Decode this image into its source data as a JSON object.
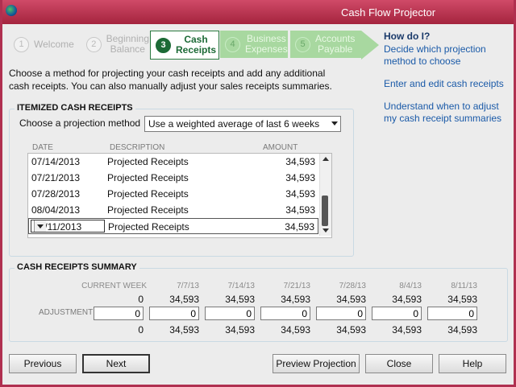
{
  "window": {
    "title": "Cash Flow Projector"
  },
  "wizard": {
    "steps": [
      {
        "num": "1",
        "label": "Welcome"
      },
      {
        "num": "2",
        "label": "Beginning\nBalance"
      },
      {
        "num": "3",
        "label": "Cash\nReceipts"
      },
      {
        "num": "4",
        "label": "Business\nExpenses"
      },
      {
        "num": "5",
        "label": "Accounts\nPayable"
      }
    ]
  },
  "intro": "Choose a method for projecting your cash receipts and add any additional cash receipts. You can also manually adjust your sales receipts summaries.",
  "help": {
    "header": "How do I?",
    "links": [
      "Decide which projection method to choose",
      "Enter and edit cash receipts",
      "Understand when to adjust my cash receipt summaries"
    ]
  },
  "itemized": {
    "title": "ITEMIZED CASH RECEIPTS",
    "method_label": "Choose a projection method",
    "method_value": "Use a weighted average of last 6 weeks",
    "columns": [
      "DATE",
      "DESCRIPTION",
      "AMOUNT"
    ],
    "rows": [
      {
        "date": "07/14/2013",
        "desc": "Projected Receipts",
        "amount": "34,593"
      },
      {
        "date": "07/21/2013",
        "desc": "Projected Receipts",
        "amount": "34,593"
      },
      {
        "date": "07/28/2013",
        "desc": "Projected Receipts",
        "amount": "34,593"
      },
      {
        "date": "08/04/2013",
        "desc": "Projected Receipts",
        "amount": "34,593"
      },
      {
        "date": "08/11/2013",
        "desc": "Projected Receipts",
        "amount": "34,593"
      }
    ]
  },
  "summary": {
    "title": "CASH RECEIPTS SUMMARY",
    "adjustment_label": "ADJUSTMENT",
    "columns": [
      {
        "head": "CURRENT WEEK",
        "top": "0",
        "adj": "0",
        "bottom": "0"
      },
      {
        "head": "7/7/13",
        "top": "34,593",
        "adj": "0",
        "bottom": "34,593"
      },
      {
        "head": "7/14/13",
        "top": "34,593",
        "adj": "0",
        "bottom": "34,593"
      },
      {
        "head": "7/21/13",
        "top": "34,593",
        "adj": "0",
        "bottom": "34,593"
      },
      {
        "head": "7/28/13",
        "top": "34,593",
        "adj": "0",
        "bottom": "34,593"
      },
      {
        "head": "8/4/13",
        "top": "34,593",
        "adj": "0",
        "bottom": "34,593"
      },
      {
        "head": "8/11/13",
        "top": "34,593",
        "adj": "0",
        "bottom": "34,593"
      }
    ]
  },
  "buttons": {
    "previous": "Previous",
    "next": "Next",
    "preview": "Preview Projection",
    "close": "Close",
    "help": "Help"
  }
}
